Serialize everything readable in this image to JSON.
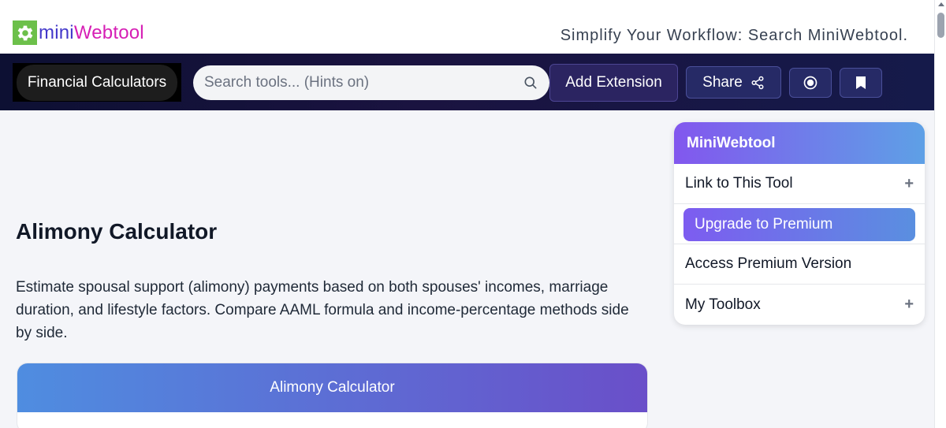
{
  "header": {
    "logo_mini": "mini",
    "logo_web": "Webtool",
    "tagline": "Simplify Your Workflow: Search MiniWebtool."
  },
  "nav": {
    "category_label": "Financial Calculators",
    "search_placeholder": "Search tools... (Hints on)",
    "extension_label": "Add Extension",
    "share_label": "Share"
  },
  "main": {
    "title": "Alimony Calculator",
    "description": "Estimate spousal support (alimony) payments based on both spouses' incomes, marriage duration, and lifestyle factors. Compare AAML formula and income-percentage methods side by side.",
    "card_title": "Alimony Calculator"
  },
  "sidebar": {
    "title": "MiniWebtool",
    "link_label": "Link to This Tool",
    "upgrade_label": "Upgrade to Premium",
    "premium_label": "Access Premium Version",
    "toolbox_label": "My Toolbox",
    "plus_symbol": "+"
  },
  "colors": {
    "accent_purple": "#7d5cf0",
    "accent_blue": "#5a8fe0",
    "nav_bg": "#0d1033",
    "logo_green": "#6cc04a",
    "logo_magenta": "#d61fb5"
  },
  "icons": [
    "gear-icon",
    "search-icon",
    "share-icon",
    "record-icon",
    "bookmark-icon"
  ]
}
